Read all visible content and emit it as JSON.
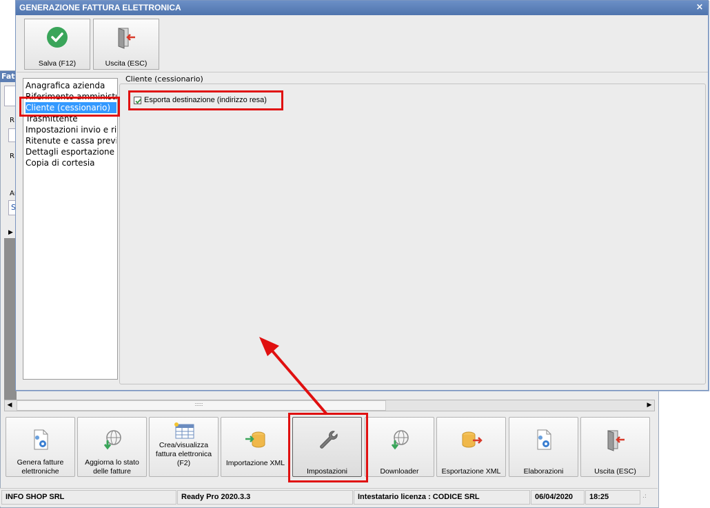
{
  "background_window": {
    "title": "Fatt",
    "field_labels": [
      "Ri",
      "Ri",
      "An"
    ],
    "field_value": "S"
  },
  "dialog": {
    "title": "GENERAZIONE FATTURA ELETTRONICA",
    "close_glyph": "×",
    "toolbar": [
      {
        "label": "Salva (F12)",
        "icon": "check-circle-icon"
      },
      {
        "label": "Uscita (ESC)",
        "icon": "exit-door-icon"
      }
    ],
    "nav_items": [
      "Anagrafica azienda",
      "Riferimento amministrativo",
      "Cliente (cessionario)",
      "Trasmittente",
      "Impostazioni invio e ricezione",
      "Ritenute e cassa previdenziale",
      "Dettagli esportazione",
      "Copia di cortesia"
    ],
    "selected_nav_index": 2,
    "group_title": "Cliente (cessionario)",
    "checkbox": {
      "label": "Esporta destinazione (indirizzo resa)",
      "checked": true
    }
  },
  "bottom_toolbar": [
    {
      "label": "Genera fatture elettroniche",
      "icon": "document-gear-icon"
    },
    {
      "label": "Aggiorna lo stato delle fatture",
      "icon": "globe-download-icon"
    },
    {
      "label": "Crea/visualizza fattura elettronica (F2)",
      "icon": "table-sparkle-icon"
    },
    {
      "label": "Importazione XML",
      "icon": "database-import-icon"
    },
    {
      "label": "Impostazioni",
      "icon": "wrench-icon"
    },
    {
      "label": "Downloader",
      "icon": "globe-download-icon"
    },
    {
      "label": "Esportazione XML",
      "icon": "database-export-icon"
    },
    {
      "label": "Elaborazioni",
      "icon": "document-gear-icon"
    },
    {
      "label": "Uscita (ESC)",
      "icon": "exit-door-icon"
    }
  ],
  "status_bar": {
    "company": "INFO SHOP SRL",
    "version": "Ready Pro 2020.3.3",
    "license": "Intestatario licenza : CODICE SRL",
    "date": "06/04/2020",
    "time": "18:25"
  },
  "colors": {
    "title_bar": "#5a7fb8",
    "selection": "#3399ff",
    "highlight": "#e01010",
    "accent_green": "#3aa55a"
  }
}
